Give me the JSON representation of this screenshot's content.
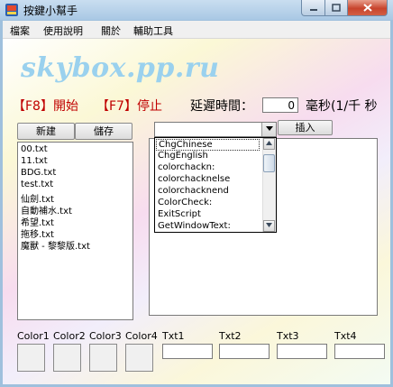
{
  "window": {
    "title": "按鍵小幫手",
    "app_icon": "app-icon",
    "controls": {
      "minimize": "minimize-icon",
      "maximize": "maximize-icon",
      "close": "close-icon"
    }
  },
  "menu": [
    "檔案",
    "使用說明",
    "關於",
    "輔助工具"
  ],
  "banner": "skybox.pp.ru",
  "controls_row": {
    "f8_label": "【F8】開始",
    "f7_label": "【F7】停止",
    "delay_label": "延遲時間：",
    "delay_value": "0",
    "delay_unit": "毫秒(1/千 秒"
  },
  "buttons": {
    "new": "新建",
    "save": "儲存",
    "insert": "插入"
  },
  "file_list": [
    "00.txt",
    "11.txt",
    "BDG.txt",
    "test.txt",
    "仙劍.txt",
    "自動補水.txt",
    "希望.txt",
    "拖移.txt",
    "魔獸 - 黎黎版.txt"
  ],
  "command_dropdown": {
    "selected": "",
    "options": [
      "ChgChinese",
      "ChgEnglish",
      "colorchackn:",
      "colorchacknelse",
      "colorchacknend",
      "ColorCheck:",
      "ExitScript",
      "GetWindowText:"
    ]
  },
  "script_text": "",
  "color_slots": [
    "Color1",
    "Color2",
    "Color3",
    "Color4"
  ],
  "text_slots": [
    "Txt1",
    "Txt2",
    "Txt3",
    "Txt4"
  ]
}
